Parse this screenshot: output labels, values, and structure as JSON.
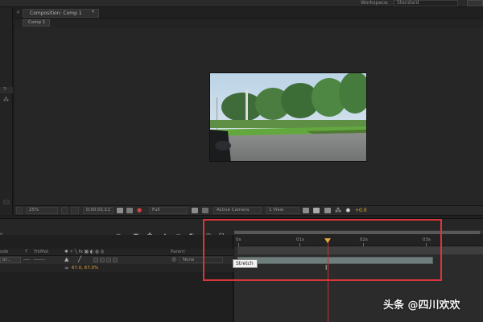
{
  "app": {
    "workspace_label": "Workspace:",
    "workspace_value": "Standard"
  },
  "left_panel": {
    "tab_label": "Tr"
  },
  "composition": {
    "tab_label": "Composition: Comp 1",
    "subtab_label": "Comp 1"
  },
  "comp_footer": {
    "zoom": "25%",
    "timecode": "0;00;01;11",
    "resolution": "Full",
    "camera": "Active Camera",
    "views": "1 View",
    "exposure": "+0.0"
  },
  "timeline": {
    "ruler_labels": [
      "0s",
      "01s",
      "02s",
      "03s"
    ],
    "columns": {
      "mode": "ode",
      "t": "T",
      "trkmat": "TrkMat",
      "parent": "Parent"
    },
    "layer": {
      "mode_value": "or...",
      "parent_value": "None",
      "scale_value": "67.0, 67.0%"
    },
    "tooltip": "Stretch"
  },
  "watermark": "头条 @四川欢欢",
  "colors": {
    "highlight": "#d8363a",
    "playhead": "#c4302b",
    "playhead_cap": "#e8a83c",
    "accent_value": "#e0a23a"
  }
}
